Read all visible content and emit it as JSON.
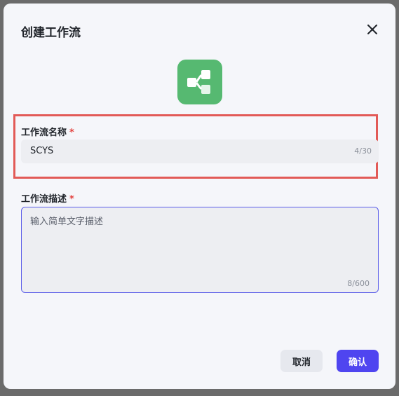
{
  "dialog": {
    "title": "创建工作流",
    "close_icon": "close-icon",
    "app_icon": "workflow-icon"
  },
  "name_field": {
    "label": "工作流名称",
    "required_mark": "*",
    "value": "SCYS",
    "counter": "4/30"
  },
  "desc_field": {
    "label": "工作流描述",
    "required_mark": "*",
    "placeholder": "输入简单文字描述",
    "counter": "8/600"
  },
  "buttons": {
    "cancel": "取消",
    "confirm": "确认"
  },
  "colors": {
    "accent": "#4f45f0",
    "icon_bg": "#56b971",
    "highlight_border": "#e25a57",
    "required": "#e3413e"
  }
}
